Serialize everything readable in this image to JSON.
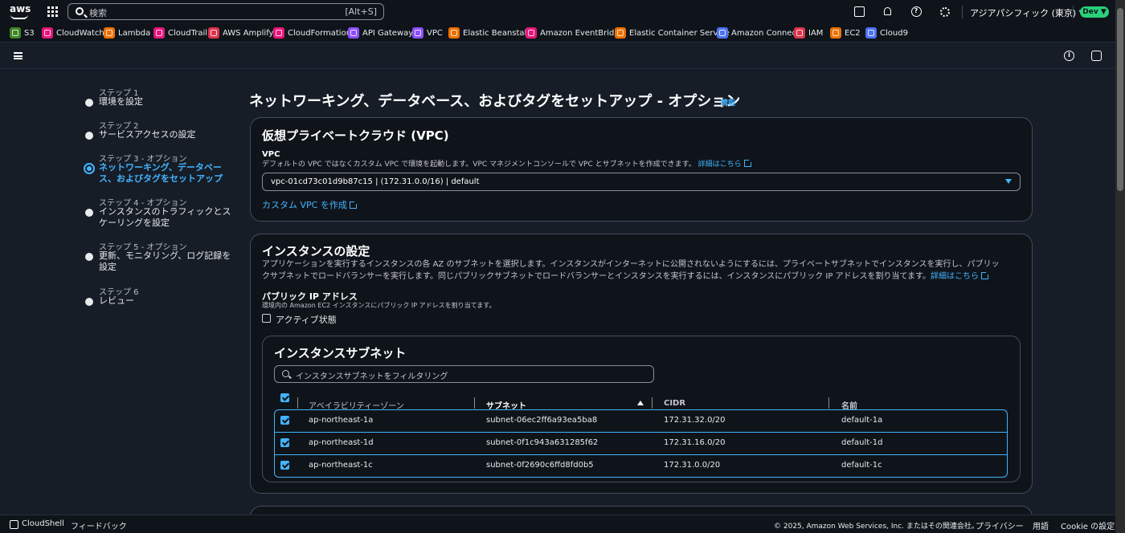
{
  "topnav": {
    "search_placeholder": "検索",
    "search_shortcut": "[Alt+S]",
    "region": "アジアパシフィック (東京) ▼",
    "account_badge": "Dev ▼"
  },
  "favorites": [
    {
      "label": "S3",
      "color": "#3f8624"
    },
    {
      "label": "CloudWatch",
      "color": "#e7157b"
    },
    {
      "label": "Lambda",
      "color": "#ed7100"
    },
    {
      "label": "CloudTrail",
      "color": "#e7157b"
    },
    {
      "label": "AWS Amplify",
      "color": "#dd344c"
    },
    {
      "label": "CloudFormation",
      "color": "#e7157b"
    },
    {
      "label": "API Gateway",
      "color": "#8c4fff"
    },
    {
      "label": "VPC",
      "color": "#8c4fff"
    },
    {
      "label": "Elastic Beanstalk",
      "color": "#ed7100"
    },
    {
      "label": "Amazon EventBridge",
      "color": "#e7157b"
    },
    {
      "label": "Elastic Container Service",
      "color": "#ed7100"
    },
    {
      "label": "Amazon Connect",
      "color": "#4d72f3"
    },
    {
      "label": "IAM",
      "color": "#dd344c"
    },
    {
      "label": "EC2",
      "color": "#ed7100"
    },
    {
      "label": "Cloud9",
      "color": "#4d72f3"
    }
  ],
  "steps": [
    {
      "small": "ステップ 1",
      "title": "環境を設定",
      "active": false
    },
    {
      "small": "ステップ 2",
      "title": "サービスアクセスの設定",
      "active": false
    },
    {
      "small": "ステップ 3 - オプション",
      "title": "ネットワーキング、データベース、およびタグをセットアップ",
      "active": true
    },
    {
      "small": "ステップ 4 - オプション",
      "title": "インスタンスのトラフィックとスケーリングを設定",
      "active": false
    },
    {
      "small": "ステップ 5 - オプション",
      "title": "更新、モニタリング、ログ記録を設定",
      "active": false
    },
    {
      "small": "ステップ 6",
      "title": "レビュー",
      "active": false
    }
  ],
  "page": {
    "title": "ネットワーキング、データベース、およびタグをセットアップ - オプション",
    "info": "情報"
  },
  "vpc_panel": {
    "title": "仮想プライベートクラウド (VPC)",
    "field_label": "VPC",
    "field_desc": "デフォルトの VPC ではなくカスタム VPC で環境を起動します。VPC マネジメントコンソールで VPC とサブネットを作成できます。",
    "details_link": "詳細はこちら",
    "selected_vpc": "vpc-01cd73c01d9b87c15 | (172.31.0.0/16) | default",
    "create_link": "カスタム VPC を作成"
  },
  "instance_panel": {
    "title": "インスタンスの設定",
    "desc_line1": "アプリケーションを実行するインスタンスの各 AZ のサブネットを選択します。インスタンスがインターネットに公開されないようにするには、プライベートサブネットでインスタンスを実行し、パブリッ",
    "desc_line2": "クサブネットでロードバランサーを実行します。同じパブリックサブネットでロードバランサーとインスタンスを実行するには、インスタンスにパブリック IP アドレスを割り当てます。",
    "details_link": "詳細はこちら",
    "public_ip_label": "パブリック IP アドレス",
    "public_ip_desc": "環境内の Amazon EC2 インスタンスにパブリック IP アドレスを割り当てます。",
    "active_label": "アクティブ状態"
  },
  "subnets": {
    "title": "インスタンスサブネット",
    "filter_placeholder": "インスタンスサブネットをフィルタリング",
    "columns": [
      "アベイラビリティーゾーン",
      "サブネット",
      "CIDR",
      "名前"
    ],
    "rows": [
      {
        "az": "ap-northeast-1a",
        "subnet": "subnet-06ec2ff6a93ea5ba8",
        "cidr": "172.31.32.0/20",
        "name": "default-1a"
      },
      {
        "az": "ap-northeast-1d",
        "subnet": "subnet-0f1c943a631285f62",
        "cidr": "172.31.16.0/20",
        "name": "default-1d"
      },
      {
        "az": "ap-northeast-1c",
        "subnet": "subnet-0f2690c6ffd8fd0b5",
        "cidr": "172.31.0.0/20",
        "name": "default-1c"
      }
    ]
  },
  "footer": {
    "cloudshell": "CloudShell",
    "feedback": "フィードバック",
    "copyright": "© 2025, Amazon Web Services, Inc. またはその関連会社。",
    "privacy": "プライバシー",
    "terms": "用語",
    "cookie": "Cookie の設定"
  },
  "colors": {
    "accent": "#42b4ff",
    "dev_badge": "#29d17a",
    "background": "#0f141a"
  }
}
